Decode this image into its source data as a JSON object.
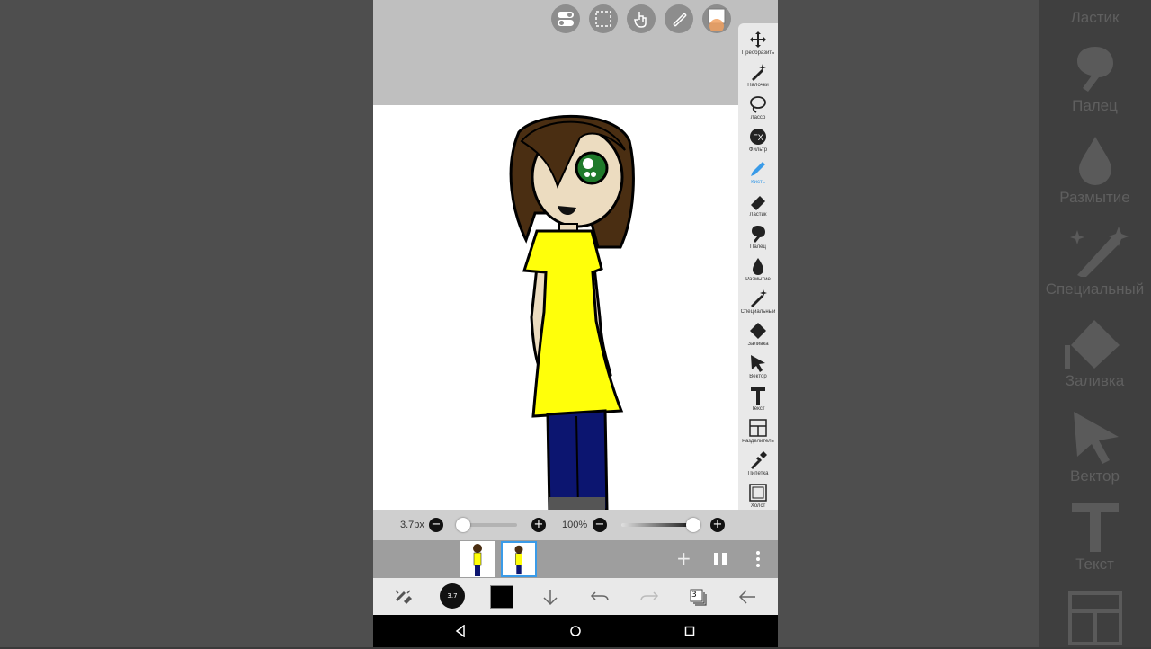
{
  "toolbar": {
    "tools": [
      {
        "label": "Преобразить",
        "icon": "move-icon"
      },
      {
        "label": "Палочки",
        "icon": "magic-wand-icon"
      },
      {
        "label": "Лассо",
        "icon": "lasso-icon"
      },
      {
        "label": "Фильтр",
        "icon": "filter-fx-icon"
      },
      {
        "label": "Кисть",
        "icon": "brush-icon",
        "active": true
      },
      {
        "label": "Ластик",
        "icon": "eraser-icon"
      },
      {
        "label": "Палец",
        "icon": "finger-smudge-icon"
      },
      {
        "label": "Размытие",
        "icon": "blur-drop-icon"
      },
      {
        "label": "Специальный",
        "icon": "special-brush-icon"
      },
      {
        "label": "Заливка",
        "icon": "fill-bucket-icon"
      },
      {
        "label": "Вектор",
        "icon": "vector-cursor-icon"
      },
      {
        "label": "Текст",
        "icon": "text-icon"
      },
      {
        "label": "Разделитель",
        "icon": "frame-divider-icon"
      },
      {
        "label": "Пипетка",
        "icon": "eyedropper-icon"
      },
      {
        "label": "Холст",
        "icon": "canvas-icon"
      }
    ]
  },
  "side_panel": {
    "items": [
      "Ластик",
      "Палец",
      "Размытие",
      "Специальный",
      "Заливка",
      "Вектор",
      "Текст"
    ]
  },
  "brush": {
    "size_label": "3.7px",
    "size_fraction": 0.0,
    "opacity_label": "100%",
    "opacity_fraction": 1.0
  },
  "frames": {
    "count": 2,
    "active_index": 1
  },
  "bottom": {
    "brush_size_badge": "3.7",
    "layers_count": "3"
  },
  "colors": {
    "accent": "#3a9be8",
    "current_color": "#000000",
    "dress": "#ffff0a",
    "hair": "#4a2e12",
    "skin": "#ecdcc0",
    "pants": "#0c1570",
    "eye": "#1f7a2a"
  }
}
